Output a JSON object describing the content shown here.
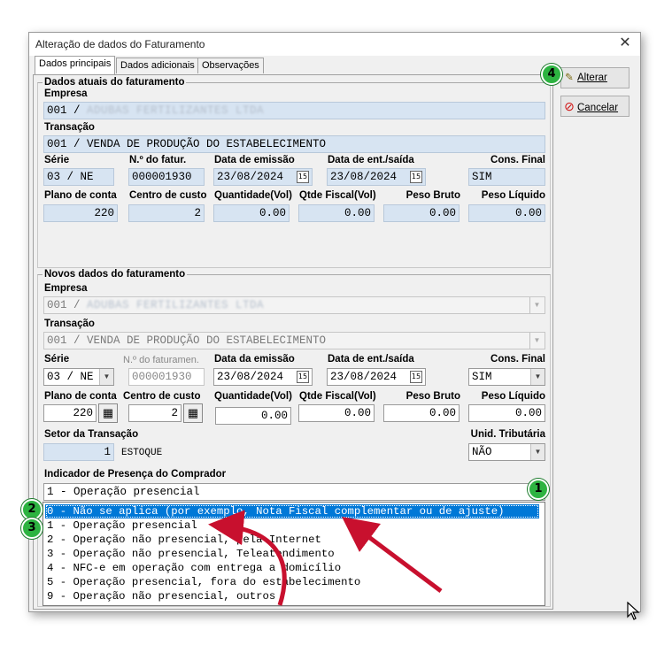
{
  "window": {
    "title": "Alteração de dados do Faturamento",
    "close_glyph": "✕"
  },
  "tabs": [
    {
      "label": "Dados principais",
      "active": true
    },
    {
      "label": "Dados adicionais",
      "active": false
    },
    {
      "label": "Observações",
      "active": false
    }
  ],
  "buttons": {
    "alterar": "Alterar",
    "cancelar": "Cancelar"
  },
  "current": {
    "group_title": "Dados atuais do faturamento",
    "empresa_label": "Empresa",
    "empresa_prefix": "001 /",
    "empresa_blurred": "ADUBAS FERTILIZANTES LTDA",
    "transacao_label": "Transação",
    "transacao_value": "001 / VENDA DE PRODUÇÃO DO ESTABELECIMENTO",
    "serie_label": "Série",
    "serie_value": "03 / NE",
    "nfatur_label": "N.º do fatur.",
    "nfatur_value": "000001930",
    "emissao_label": "Data de emissão",
    "emissao_value": "23/08/2024",
    "entsaida_label": "Data de ent./saída",
    "entsaida_value": "23/08/2024",
    "consfinal_label": "Cons. Final",
    "consfinal_value": "SIM",
    "plano_label": "Plano de conta",
    "plano_value": "220",
    "centro_label": "Centro de custo",
    "centro_value": "2",
    "qtdvol_label": "Quantidade(Vol)",
    "qtdvol_value": "0.00",
    "qtdfiscal_label": "Qtde Fiscal(Vol)",
    "qtdfiscal_value": "0.00",
    "pesobruto_label": "Peso Bruto",
    "pesobruto_value": "0.00",
    "pesoliq_label": "Peso Líquido",
    "pesoliq_value": "0.00"
  },
  "new": {
    "group_title": "Novos dados do faturamento",
    "empresa_label": "Empresa",
    "empresa_prefix": "001 /",
    "empresa_blurred": "ADUBAS FERTILIZANTES LTDA",
    "transacao_label": "Transação",
    "transacao_value": "001 / VENDA DE PRODUÇÃO DO ESTABELECIMENTO",
    "serie_label": "Série",
    "serie_value": "03 / NE",
    "nfaturamen_label": "N.º do faturamen.",
    "nfaturamen_value": "000001930",
    "emissao_label": "Data da emissão",
    "emissao_value": "23/08/2024",
    "entsaida_label": "Data de ent./saída",
    "entsaida_value": "23/08/2024",
    "consfinal_label": "Cons. Final",
    "consfinal_value": "SIM",
    "plano_label": "Plano de conta",
    "plano_value": "220",
    "centro_label": "Centro de custo",
    "centro_value": "2",
    "qtdvol_label": "Quantidade(Vol)",
    "qtdvol_value": "0.00",
    "qtdfiscal_label": "Qtde Fiscal(Vol)",
    "qtdfiscal_value": "0.00",
    "pesobruto_label": "Peso Bruto",
    "pesobruto_value": "0.00",
    "pesoliq_label": "Peso Líquido",
    "pesoliq_value": "0.00",
    "setor_label": "Setor da Transação",
    "setor_value": "1",
    "setor_desc": "ESTOQUE",
    "unid_label": "Unid. Tributária",
    "unid_value": "NÃO"
  },
  "indicador": {
    "label": "Indicador de Presença do Comprador",
    "selected": "1 - Operação presencial",
    "options": [
      "0 - Não se aplica (por exemplo, Nota Fiscal complementar ou de ajuste)",
      "1 - Operação presencial",
      "2 - Operação não presencial, pela Internet",
      "3 - Operação não presencial, Teleatendimento",
      "4 - NFC-e em operação com entrega a domicílio",
      "5 - Operação presencial, fora do estabelecimento",
      "9 - Operação não presencial, outros"
    ],
    "highlighted_index": 0
  },
  "badges": {
    "b1": "1",
    "b2": "2",
    "b3": "3",
    "b4": "4"
  },
  "icons": {
    "calendar": "calendar-icon",
    "dropdown": "chevron-down-icon",
    "picker": "lookup-icon",
    "edit": "edit-icon",
    "cancel": "cancel-icon",
    "cursor": "mouse-cursor-icon"
  },
  "colors": {
    "selection": "#0078d7",
    "field_fill": "#d7e4f2",
    "badge_green": "#2db341",
    "arrow_red": "#c8102e"
  }
}
